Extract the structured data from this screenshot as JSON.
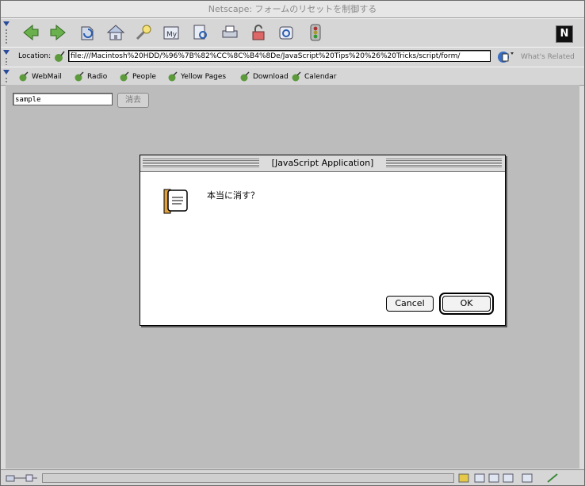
{
  "window": {
    "title": "Netscape: フォームのリセットを制御する"
  },
  "nav_toolbar": {
    "buttons": [
      "back-icon",
      "forward-icon",
      "reload-icon",
      "home-icon",
      "search-icon",
      "my-netscape-icon",
      "guide-icon",
      "print-icon",
      "security-icon",
      "shop-icon",
      "stop-icon"
    ],
    "logo": "N"
  },
  "location_bar": {
    "label": "Location:",
    "url": "file:///Macintosh%20HDD/%96%7B%82%CC%8C%B4%8De/JavaScript%20Tips%20%26%20Tricks/script/form/",
    "related_label": "What's Related"
  },
  "personal_toolbar": {
    "items": [
      "WebMail",
      "Radio",
      "People",
      "Yellow Pages",
      "Download",
      "Calendar"
    ]
  },
  "page": {
    "text_value": "sample",
    "button_label": "消去"
  },
  "dialog": {
    "title": "[JavaScript Application]",
    "message": "本当に消す？",
    "cancel_label": "Cancel",
    "ok_label": "OK"
  },
  "colors": {
    "desktop": "#c6c6c6",
    "chrome": "#d6d6d6",
    "content_bg": "#bcbcbc"
  }
}
